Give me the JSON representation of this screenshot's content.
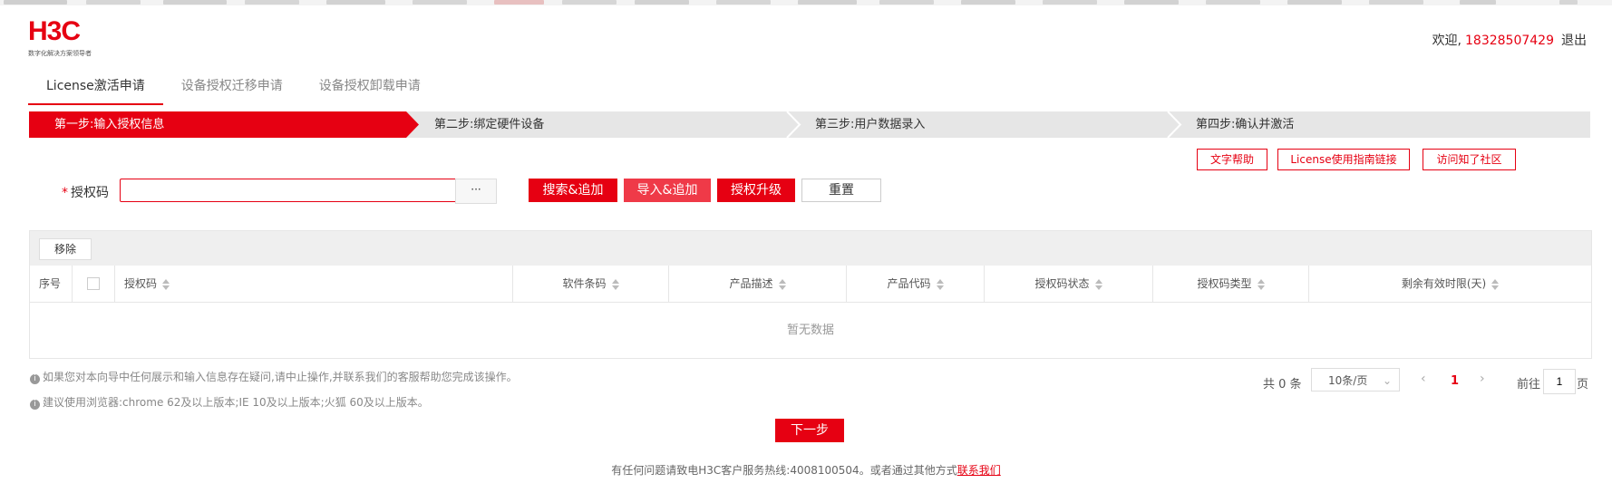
{
  "brand": {
    "logo_text": "H3C",
    "tagline": "数字化解决方案领导者",
    "accent": "#e60012"
  },
  "header": {
    "welcome": "欢迎,",
    "username": "18328507429",
    "logout": "退出"
  },
  "tabs": [
    {
      "label": "License激活申请",
      "active": true
    },
    {
      "label": "设备授权迁移申请",
      "active": false
    },
    {
      "label": "设备授权卸载申请",
      "active": false
    }
  ],
  "steps": [
    {
      "label": "第一步:输入授权信息",
      "active": true
    },
    {
      "label": "第二步:绑定硬件设备",
      "active": false
    },
    {
      "label": "第三步:用户数据录入",
      "active": false
    },
    {
      "label": "第四步:确认并激活",
      "active": false
    }
  ],
  "help_links": {
    "text_help": "文字帮助",
    "guide": "License使用指南链接",
    "community": "访问知了社区"
  },
  "form": {
    "required_mark": "*",
    "auth_label": "授权码",
    "auth_value": "",
    "more": "···",
    "search_add": "搜索&追加",
    "import_add": "导入&追加",
    "upgrade": "授权升级",
    "reset": "重置"
  },
  "table": {
    "remove": "移除",
    "columns": {
      "index": "序号",
      "auth_code": "授权码",
      "software_code": "软件条码",
      "product_desc": "产品描述",
      "product_code": "产品代码",
      "auth_status": "授权码状态",
      "auth_type": "授权码类型",
      "remaining": "剩余有效时限(天)"
    },
    "empty": "暂无数据"
  },
  "notes": {
    "line1": "如果您对本向导中任何展示和输入信息存在疑问,请中止操作,并联系我们的客服帮助您完成该操作。",
    "line2": "建议使用浏览器:chrome 62及以上版本;IE 10及以上版本;火狐 60及以上版本。"
  },
  "pagination": {
    "total": "共 0 条",
    "page_size": "10条/页",
    "current": "1",
    "goto": "前往",
    "goto_value": "1",
    "page_suffix": "页"
  },
  "next_button": "下一步",
  "footer": {
    "text": "有任何问题请致电H3C客户服务热线:4008100504。或者通过其他方式",
    "link": "联系我们"
  }
}
